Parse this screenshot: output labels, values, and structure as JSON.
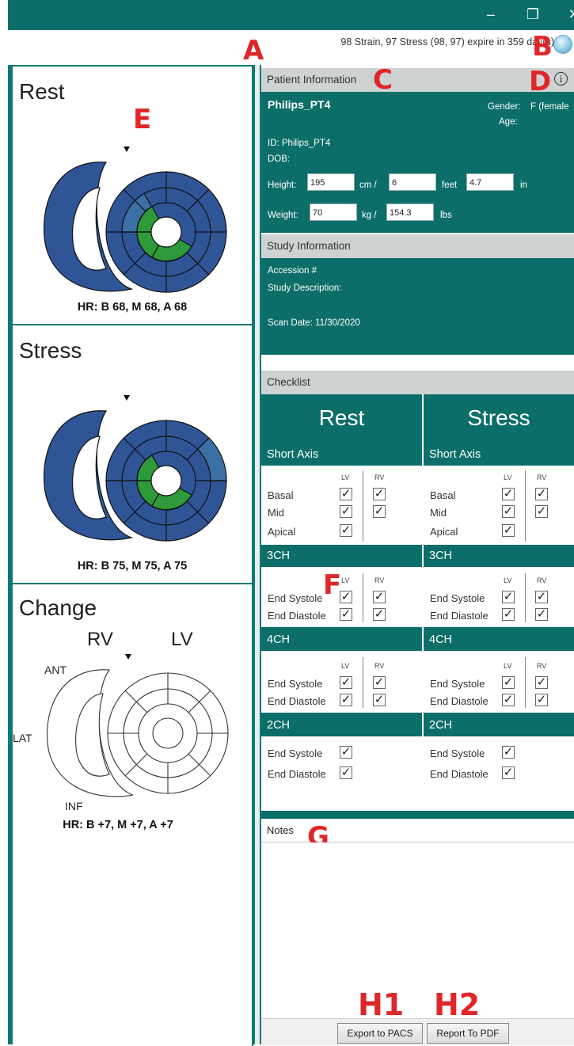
{
  "window": {
    "minimize_glyph": "–",
    "restore_glyph": "❐",
    "close_glyph": "✕"
  },
  "license": {
    "text": "98 Strain, 97 Stress (98, 97) expire in 359 day(s)"
  },
  "markers": {
    "A": "A",
    "B": "B",
    "C": "C",
    "D": "D",
    "E": "E",
    "F": "F",
    "G": "G",
    "H1": "H1",
    "H2": "H2"
  },
  "left": {
    "rest": {
      "title": "Rest",
      "hr": "HR: B 68, M 68, A 68"
    },
    "stress": {
      "title": "Stress",
      "hr": "HR: B 75, M 75, A 75"
    },
    "change": {
      "title": "Change",
      "rv": "RV",
      "lv": "LV",
      "ant": "ANT",
      "lat": "LAT",
      "inf": "INF",
      "hr": "HR: B +7, M +7, A +7"
    }
  },
  "patient": {
    "header": "Patient Information",
    "name": "Philips_PT4",
    "gender_label": "Gender:",
    "gender_value": "F  (female",
    "age_label": "Age:",
    "id": "ID: Philips_PT4",
    "dob": "DOB:",
    "height_label": "Height:",
    "height_cm": "195",
    "cm_unit": "cm /",
    "height_ft": "6",
    "ft_unit": "feet",
    "height_in": "4.7",
    "in_unit": "in",
    "weight_label": "Weight:",
    "weight_kg": "70",
    "kg_unit": "kg /",
    "weight_lbs": "154.3",
    "lbs_unit": "lbs"
  },
  "study": {
    "header": "Study Information",
    "accession": "Accession #",
    "description": "Study Description:",
    "scan_date": "Scan Date: 11/30/2020"
  },
  "checklist": {
    "header": "Checklist",
    "rest_title": "Rest",
    "stress_title": "Stress",
    "short_axis": "Short Axis",
    "ch3": "3CH",
    "ch4": "4CH",
    "ch2": "2CH",
    "lv": "LV",
    "rv": "RV",
    "basal": "Basal",
    "mid": "Mid",
    "apical": "Apical",
    "end_systole": "End Systole",
    "end_diastole": "End Diastole",
    "check_glyph": "✓"
  },
  "notes": {
    "header": "Notes",
    "value": ""
  },
  "buttons": {
    "export_pacs": "Export to PACS",
    "report_pdf": "Report To PDF"
  },
  "colors": {
    "teal": "#0c6e69",
    "segment_blue": "#2f5597",
    "segment_green": "#2e9a3a",
    "marker_red": "#e0262a"
  }
}
